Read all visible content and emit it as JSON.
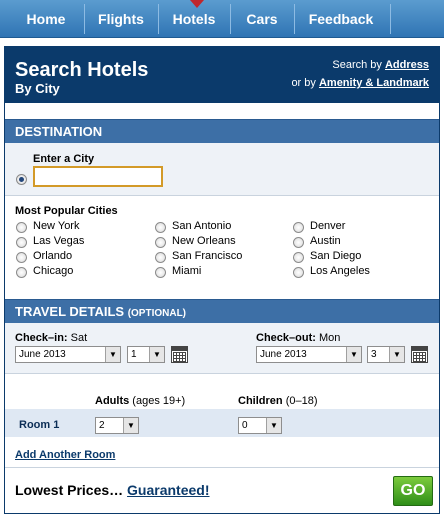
{
  "nav": {
    "items": [
      "Home",
      "Flights",
      "Hotels",
      "Cars",
      "Feedback"
    ],
    "active": "Hotels"
  },
  "header": {
    "title": "Search Hotels",
    "subtitle": "By City",
    "search_by_prefix": "Search by",
    "search_by_link": "Address",
    "or_by_prefix": "or by",
    "or_by_link": "Amenity & Landmark"
  },
  "destination": {
    "section_title": "DESTINATION",
    "enter_city_label": "Enter a City",
    "city_value": "",
    "popular_label": "Most Popular Cities",
    "cities": [
      [
        "New York",
        "San Antonio",
        "Denver"
      ],
      [
        "Las Vegas",
        "New Orleans",
        "Austin"
      ],
      [
        "Orlando",
        "San Francisco",
        "San Diego"
      ],
      [
        "Chicago",
        "Miami",
        "Los Angeles"
      ]
    ]
  },
  "travel": {
    "section_title": "TRAVEL DETAILS",
    "optional_label": "(OPTIONAL)",
    "checkin_label": "Check–in:",
    "checkin_day": "Sat",
    "checkin_month": "June 2013",
    "checkin_date": "1",
    "checkout_label": "Check–out:",
    "checkout_day": "Mon",
    "checkout_month": "June 2013",
    "checkout_date": "3"
  },
  "rooms": {
    "adults_label": "Adults",
    "adults_hint": "(ages 19+)",
    "children_label": "Children",
    "children_hint": "(0–18)",
    "room_label": "Room 1",
    "adults_value": "2",
    "children_value": "0",
    "add_room_label": "Add Another Room"
  },
  "footer": {
    "lowest_prices": "Lowest Prices…",
    "guaranteed": "Guaranteed!",
    "go_label": "GO"
  },
  "colors": {
    "nav_blue": "#2f74b4",
    "header_navy": "#0b3a6b",
    "section_blue": "#3d6fa6",
    "go_green": "#2f8f19",
    "input_border": "#d39a28"
  }
}
